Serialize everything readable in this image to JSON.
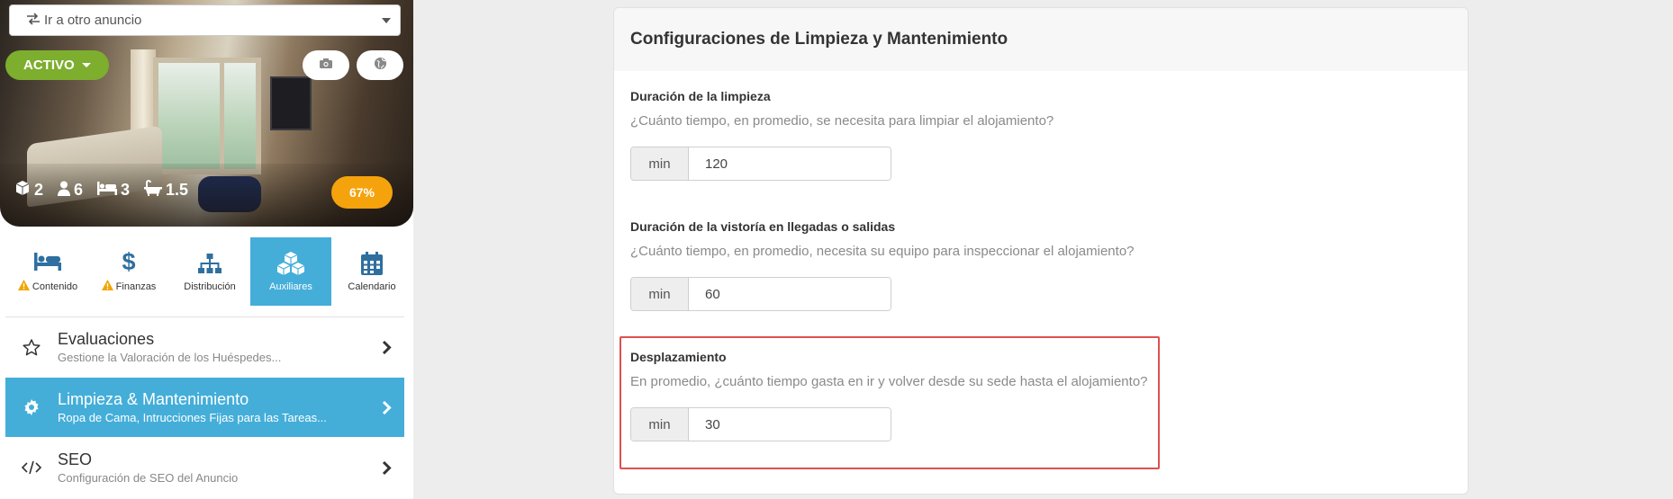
{
  "sidebar": {
    "goto_label": "Ir a otro anuncio",
    "status_label": "ACTIVO",
    "stats": [
      {
        "icon": "cube-icon",
        "value": "2"
      },
      {
        "icon": "user-icon",
        "value": "6"
      },
      {
        "icon": "bed-icon",
        "value": "3"
      },
      {
        "icon": "bath-icon",
        "value": "1.5"
      }
    ],
    "completion": "67%",
    "tabs": [
      {
        "label": "Contenido",
        "icon": "bed-icon",
        "warning": true
      },
      {
        "label": "Finanzas",
        "icon": "dollar-icon",
        "warning": true
      },
      {
        "label": "Distribución",
        "icon": "sitemap-icon",
        "warning": false
      },
      {
        "label": "Auxiliares",
        "icon": "cubes-icon",
        "warning": false,
        "active": true
      },
      {
        "label": "Calendario",
        "icon": "calendar-icon",
        "warning": false
      }
    ],
    "menu": [
      {
        "title": "Evaluaciones",
        "subtitle": "Gestione la Valoración de los Huéspedes...",
        "icon": "star-icon"
      },
      {
        "title": "Limpieza & Mantenimiento",
        "subtitle": "Ropa de Cama, Intrucciones Fijas para las Tareas...",
        "icon": "gear-icon",
        "active": true
      },
      {
        "title": "SEO",
        "subtitle": "Configuración de SEO del Anuncio",
        "icon": "code-icon"
      }
    ]
  },
  "panel": {
    "title": "Configuraciones de Limpieza y Mantenimiento",
    "fields": [
      {
        "label": "Duración de la limpieza",
        "help": "¿Cuánto tiempo, en promedio, se necesita para limpiar el alojamiento?",
        "unit": "min",
        "value": "120"
      },
      {
        "label": "Duración de la vistoría en llegadas o salidas",
        "help": "¿Cuánto tiempo, en promedio, necesita su equipo para inspeccionar el alojamiento?",
        "unit": "min",
        "value": "60"
      },
      {
        "label": "Desplazamiento",
        "help": "En promedio, ¿cuánto tiempo gasta en ir y volver desde su sede hasta el alojamiento?",
        "unit": "min",
        "value": "30"
      }
    ]
  },
  "colors": {
    "accent_blue": "#44aed9",
    "status_green": "#7dae2e",
    "completion_orange": "#f5a30c",
    "warning_yellow": "#f0a500",
    "highlight_red": "#e05050"
  }
}
